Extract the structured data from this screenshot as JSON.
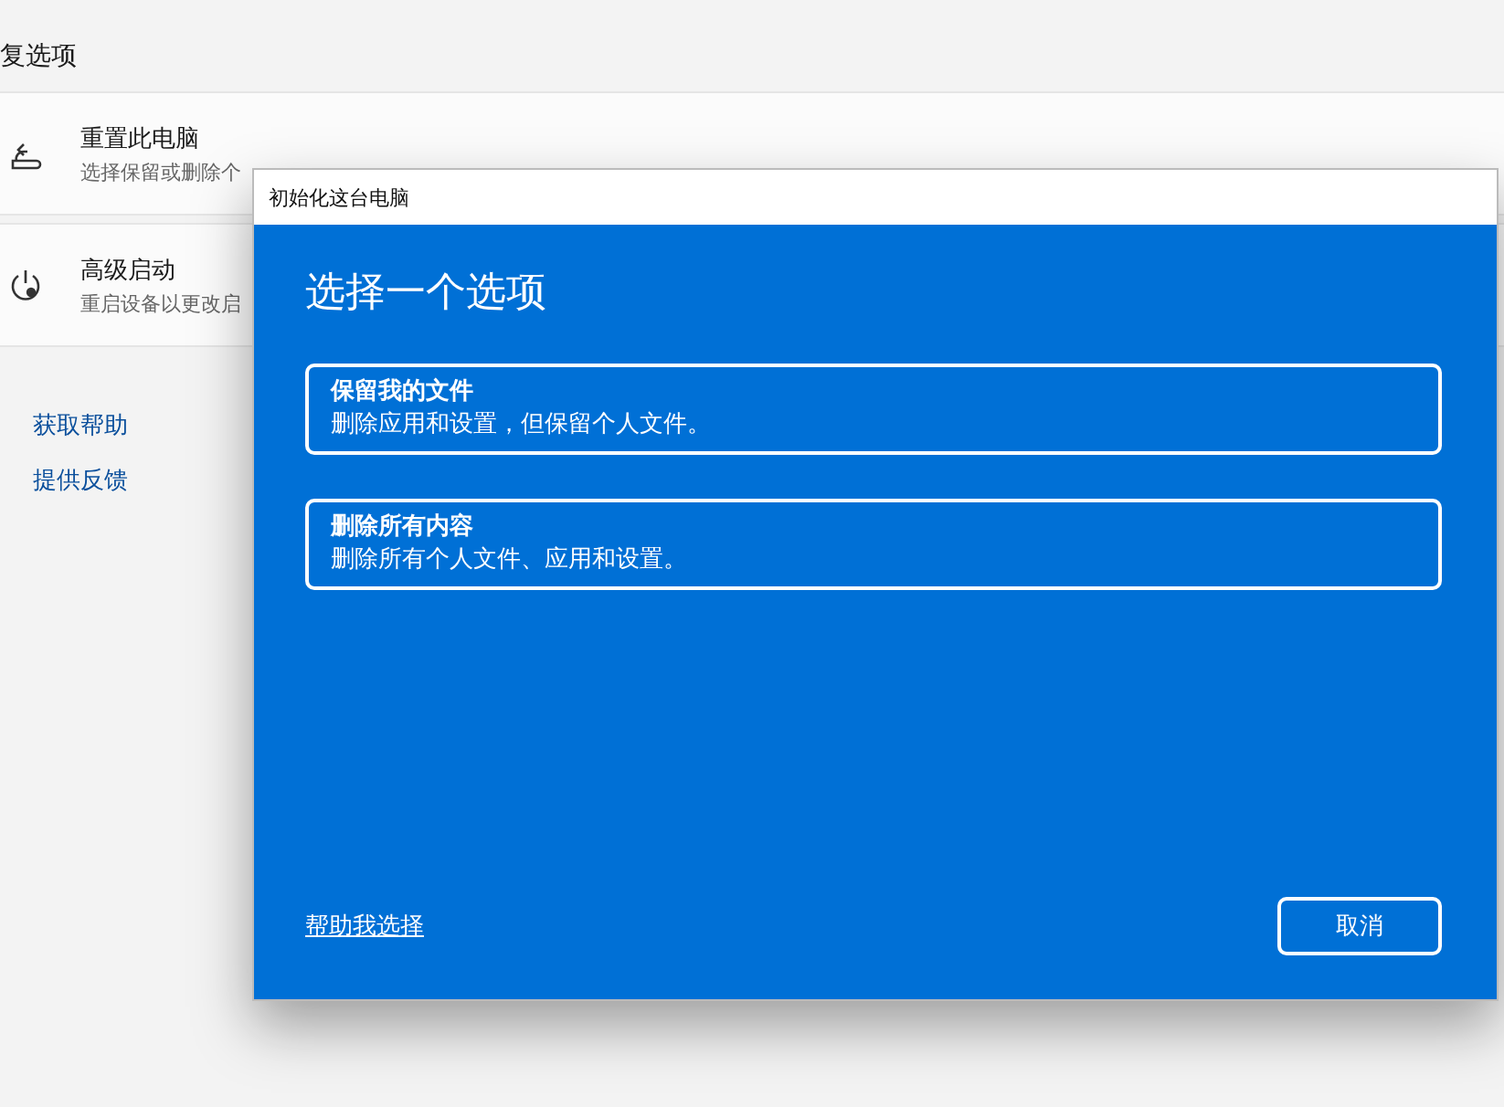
{
  "page": {
    "section_title": "复选项",
    "options": [
      {
        "kind": "reset",
        "title": "重置此电脑",
        "description": "选择保留或删除个"
      },
      {
        "kind": "startup",
        "title": "高级启动",
        "description": "重启设备以更改启"
      }
    ],
    "links": [
      "获取帮助",
      "提供反馈"
    ]
  },
  "dialog": {
    "title": "初始化这台电脑",
    "heading": "选择一个选项",
    "choices": [
      {
        "title": "保留我的文件",
        "description": "删除应用和设置，但保留个人文件。"
      },
      {
        "title": "删除所有内容",
        "description": "删除所有个人文件、应用和设置。"
      }
    ],
    "help_link": "帮助我选择",
    "cancel_button": "取消"
  }
}
